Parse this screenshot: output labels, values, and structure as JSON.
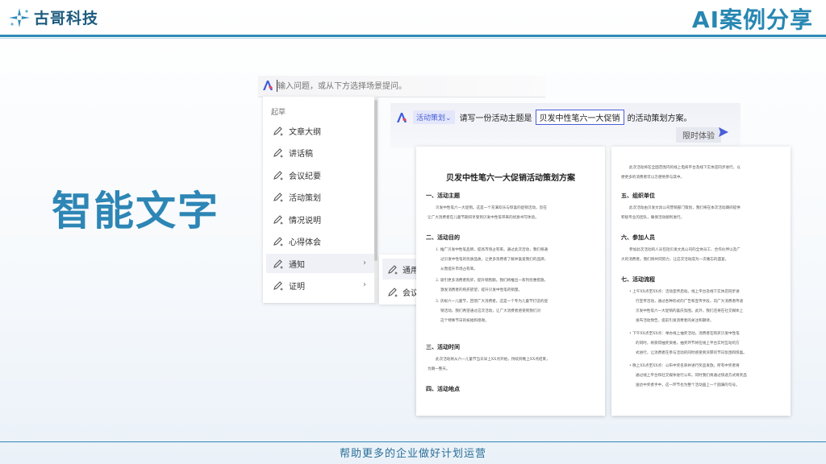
{
  "header": {
    "brand": "古哥科技",
    "title": "AI案例分享"
  },
  "slide": {
    "big_title": "智能文字",
    "footer": "帮助更多的企业做好计划运营"
  },
  "search": {
    "placeholder": "输入问题，或从下方选择场景提问。"
  },
  "menu": {
    "header": "起草",
    "items": [
      {
        "label": "文章大纲"
      },
      {
        "label": "讲话稿"
      },
      {
        "label": "会议纪要"
      },
      {
        "label": "活动策划"
      },
      {
        "label": "情况说明"
      },
      {
        "label": "心得体会"
      },
      {
        "label": "通知"
      },
      {
        "label": "证明"
      }
    ],
    "chevron": "›"
  },
  "submenu": {
    "items": [
      {
        "label": "通用"
      },
      {
        "label": "会议"
      }
    ]
  },
  "prompt": {
    "scene_chip": "活动策划",
    "chip_caret": "⌄",
    "text_before": "请写一份活动主题是",
    "highlight": "贝发中性笔六一大促销",
    "text_after": "的活动策划方案。",
    "trial_button": "限时体验"
  },
  "doc_left": {
    "title": "贝发中性笔六一大促销活动策划方案",
    "h1": "一、活动主题",
    "p1a": "贝发中性笔六一大促销。这是一个充满欢乐与惊喜的促销活动，旨在",
    "p1b": "让广大消费者在儿童节期间享受到贝发中性笔带来的优质书写体验。",
    "h2": "二、活动目的",
    "li1a": "1. 推广贝发中性笔品牌，提高市场占有率。通过此次活动，我们将通",
    "li1b": "过贝发中性笔的优质品质，让更多消费者了解并喜爱我们的品牌，",
    "li1c": "从而提升市场占有率。",
    "li2a": "2. 吸引更多消费者购买，提升销售额。我们将推出一系列优惠措施，",
    "li2b": "激发消费者的购买欲望，提升贝发中性笔的销量。",
    "li3a": "3. 庆祝六一儿童节，回馈广大消费者。这是一个专为儿童节打造的促",
    "li3b": "销活动，我们希望通过这次活动，让广大消费者感受到我们对",
    "li3c": "这个特殊节日的祝福和感谢。",
    "h3": "三、活动时间",
    "p3a": "此次活动将从六一儿童节当天早上XX点开始，持续到晚上XX点结束，",
    "p3b": "为期一整天。",
    "h4": "四、活动地点"
  },
  "doc_right": {
    "p0a": "此次活动将在全国范围内的线上电商平台及线下实体店同步进行，以",
    "p0b": "便更多的消费者可以方便地参与其中。",
    "h5": "五、组织单位",
    "p5a": "此次活动由贝发文具公司营销部门策划，我们将在本次活动期间提供",
    "p5b": "积极专业的团队，确保活动顺利进行。",
    "h6": "六、参加人员",
    "p6a": "参加此次活动的人员包括贝发文具公司的全体员工、合作伙伴以及广",
    "p6b": "大的消费者。我们将共同努力，让这次活动成为一次难忘的盛宴。",
    "h7": "七、活动流程",
    "b1a": "上午XX点至XX点：活动宣传启动。线上平台及线下实体店同步进",
    "b1b": "行宣传活动，通过各种形式的广告和宣传手段，向广大消费者传递",
    "b1c": "贝发中性笔六一大促销的喜庆氛围。此外，我们还将在社交媒体上",
    "b1d": "发布活动预告，提前引发消费者的关注和期待。",
    "b2a": "下午XX点至XX点：举办线上抽奖活动。消费者在购买贝发中性笔",
    "b2b": "的同时，将获得抽奖资格，抽奖环节将在线上平台实时互动的方",
    "b2c": "式进行，让消费者在参与活动的同时感受到浓厚的节日氛围和惊喜。",
    "b3a": "晚上XX点至XX点：公布中奖名单并进行奖品发放。所有中奖者将",
    "b3b": "通过线上平台和社交媒体进行公布，同时我们将通过快递方式将奖品",
    "b3c": "送达中奖者手中，这一环节也为整个活动画上一个圆满的句号。"
  },
  "colors": {
    "accent": "#2e8ab8",
    "title_blue": "#2d86b5",
    "chip_blue": "#4a5fd8"
  }
}
